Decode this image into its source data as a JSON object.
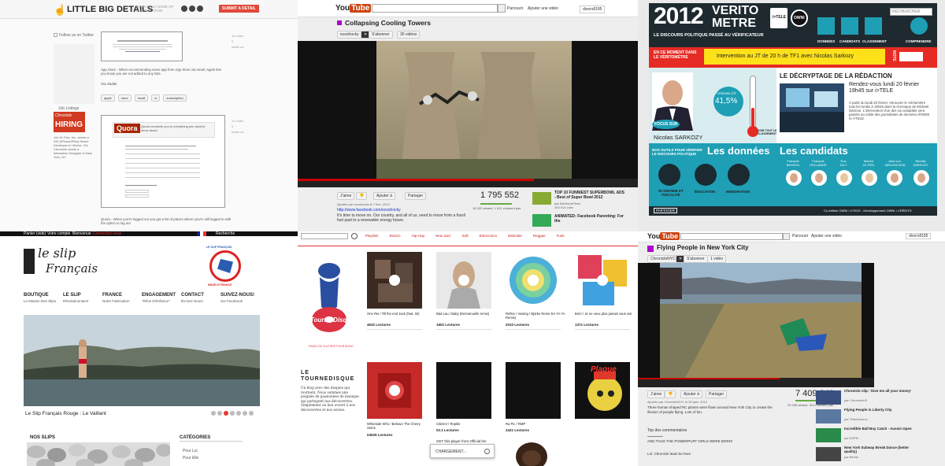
{
  "lbd": {
    "title": "LITTLE BIG DETAILS",
    "tagline": "YOUR DAILY DOSE OF UI INSPIRATION",
    "submit": "SUBMIT A DETAIL",
    "follow": "Follow us on Twitter",
    "jobs": "Job Listings",
    "hiring_top": "Chronicle",
    "hiring": "HIRING",
    "post1_text": "App Store - When recommending some app from App Store via email, Apple lets you know you are not added to any lists.",
    "post1_via": "/via vladak",
    "tags": [
      "apple",
      "store",
      "email",
      "ui",
      "subscription"
    ],
    "quora": "Quora",
    "quora_desc": "Quora connects you to everything you want to know about.",
    "post2_text": "Quora - When you're logged out you get a list of places where you're still logged in with the option to log out",
    "job_text": "Job #1 Five, Inc. needs a iOS (iPhone/iPad) Senior Developer in Venice, CA. Chronicle needs a Interactive Designer in New York, NY",
    "notes": [
      "11 notes",
      "0",
      "share url"
    ]
  },
  "yt1": {
    "logo_you": "You",
    "logo_tube": "Tube",
    "nav": [
      "Parcourir",
      "Ajouter une vidéo"
    ],
    "user": "divers8185",
    "title": "Collapsing Cooling Towers",
    "channel": "ecoshocky",
    "subscribe": "S'abonner",
    "videos": "30 vidéos",
    "like": "J'aime",
    "add": "Ajouter à",
    "share": "Partager",
    "views": "1 795 552",
    "uploader": "Ajoutée par ecoshocky le 7 févr. 2012",
    "link": "http://www.facebook.com/ecoshocky",
    "desc": "It's time to move on. Our country, and all of us, need to move from a fossil fuel past to a renewable energy future.",
    "likes": "18 322 aiment, 1 021 n'aiment pas",
    "side": [
      {
        "title": "TOP 10 FUNNIEST SUPERBOWL ADS - Best of Super Bowl 2012",
        "by": "par MediocreFilms",
        "views": "493 014 vues"
      },
      {
        "title": "ANIMATED: Facebook Parenting: For the",
        "by": "",
        "views": ""
      }
    ]
  },
  "verito": {
    "year": "2012",
    "name1": "VERITO",
    "name2": "METRE",
    "subtitle": "LE DISCOURS POLITIQUE PASSÉ AU VÉRIFICATEUR",
    "tele": "i>TELE",
    "owni": "OWNI",
    "search": "RECHERCHER",
    "nav": [
      "DONNÉES",
      "CANDIDATS",
      "CLASSEMENT",
      "COMPRENDRE"
    ],
    "now": "EN CE MOMENT DANS LE VÉRITOMÈTRE",
    "now_text": "Intervention au JT de 20 h de TF1 avec Nicolas Sarkozy",
    "note": "NOTE",
    "credibility_label": "CRÉDIBILITÉ",
    "credibility": "41,5%",
    "credibility_value": 0.415,
    "focus": "FOCUS SUR",
    "person": "Nicolas SARKOZY",
    "ranking": "VOIR TOUT LE CLASSEMENT",
    "decrypt_title": "LE DÉCRYPTAGE DE LA RÉDACTION",
    "rdv": "Rendez-vous lundi 20 février 19h45 sur i>TELE",
    "decrypt_text": "À partir du lundi 20 février, retrouvez le Véritomètre tous les lundis à 19h45 dans la chronique de Michaël Darmon. L'intervention d'un des six candidats sera passée au crible des journalistes de données d'OWNI et i>TELE.",
    "tools": "NOS OUTILS POUR VÉRIFIER LE DISCOURS POLITIQUE",
    "data_title": "Les données",
    "data_items": [
      "ÉCONOMIE ET FISCALITÉ",
      "ÉDUCATION",
      "IMMIGRATION"
    ],
    "cand_title": "Les candidats",
    "candidates": [
      {
        "first": "François",
        "last": "BAYROU"
      },
      {
        "first": "François",
        "last": "HOLLANDE"
      },
      {
        "first": "Eva",
        "last": "JOLY"
      },
      {
        "first": "Marine",
        "last": "LE PEN"
      },
      {
        "first": "Jean-Luc",
        "last": "MÉLENCHON"
      },
      {
        "first": "Nicolas",
        "last": "SARKOZY"
      }
    ],
    "share": "PARTAGER",
    "credits": "Co-édition OWNI / i>TELE - Développement OWNI • CRÉDITS"
  },
  "slip": {
    "topbar": [
      "Panier (vide)",
      "Votre compte",
      "Bienvenue",
      "Connectez-vous"
    ],
    "search": "Recherche",
    "logo1": "le slip",
    "logo2": "Français",
    "badge": "LE SLIP FRANÇAIS",
    "badge2": "MADE IN FRANCE",
    "nav": [
      {
        "t": "BOUTIQUE",
        "s": "Le Maison Des Slips"
      },
      {
        "t": "LE SLIP",
        "s": "Révolutionnaire!"
      },
      {
        "t": "FRANCE",
        "s": "Notre Fabrication"
      },
      {
        "t": "ENGAGEMENT",
        "s": "\"Rêve D'Enfance\""
      },
      {
        "t": "CONTACT",
        "s": "Écrivez Nous!"
      },
      {
        "t": "SUIVEZ-NOUS!",
        "s": "Sur Facebook"
      }
    ],
    "caption": "Le Slip Français Rouge : Le Vaillant",
    "section1": "NOS SLIPS",
    "section2": "CATÉGORIES",
    "cats": [
      "Pour Lui",
      "Pour Elle"
    ]
  },
  "tourne": {
    "tabs": [
      "Playlists",
      "Electro",
      "Hip-Hop",
      "New Jazz",
      "Soft",
      "Electronica",
      "Minimale",
      "Reggae",
      "Funk"
    ],
    "brand": "Tourne Disque",
    "tag": "RADIO DE CULTURE POUR BONO",
    "head1": "LE",
    "head2": "TOURNEDISQUE",
    "body": "Un blog avec des disques qui tournent. Nous sommes une poignée de passionnés de musique qui partagent nos découvertes. Simplement un lieu ouvert à nos découvertes et nos envies.",
    "cards": [
      {
        "title": "One Rei / Till the end Jack (feat. Ist)",
        "likes": "4632 Lectures"
      },
      {
        "title": "Bàd Lau / Baby (Emmanuelle remix)",
        "likes": "1602 Lectures"
      },
      {
        "title": "Reflex / Vowing / Björke Reine DA YA YA Remix)",
        "likes": "2010 Lectures"
      },
      {
        "title": "Born / Je ne veux plus jamais vous voir",
        "likes": "1371 Lectures"
      },
      {
        "title": "Whiteside Who / Behave The Cherry Stone",
        "likes": "04529 Lectures"
      },
      {
        "title": "Citizen! / Reptile",
        "likes": "02.1 Lectures"
      },
      {
        "title": "Ra Pic / RMP",
        "likes": "2421 Lectures"
      },
      {
        "title": "Plaque",
        "likes": ""
      }
    ],
    "get": "GET this player from Official.fm!",
    "loading": "CHARGEMENT..."
  },
  "yt2": {
    "logo_you": "You",
    "logo_tube": "Tube",
    "nav": [
      "Parcourir",
      "Ajouter une vidéo"
    ],
    "user": "divers8185",
    "title": "Flying People in New York City",
    "channel": "ChronicleNYC",
    "subscribe": "S'abonner",
    "videos": "1 vidéo",
    "like": "J'aime",
    "add": "Ajouter à",
    "share": "Partager",
    "views": "7 409 240",
    "uploader": "Ajoutée par ChronicleNYC le 30 janv. 2012",
    "desc": "Three human shaped RC planes were flown around New York City to create the illusion of people flying. Lots of fun.",
    "likes": "39 265 aiment, 314 n'aiment pas",
    "comments_head": "Top des commentaires",
    "comment1": "AND THUS THE POWERPUFF GIRLS WERE BORN!",
    "comment2": "Lol. Chronicle lead me here",
    "side": [
      {
        "title": "Chronicle clip: 'Give me all your money'",
        "by": "par ChronicleUK"
      },
      {
        "title": "Flying People in Liberty City",
        "by": "par ThisIsZoomz"
      },
      {
        "title": "Incredible Ball Boy Catch - Aussie Open",
        "by": "par ESPN"
      },
      {
        "title": "New York Subway Break Dance (better quality)",
        "by": "par Benito"
      }
    ]
  }
}
